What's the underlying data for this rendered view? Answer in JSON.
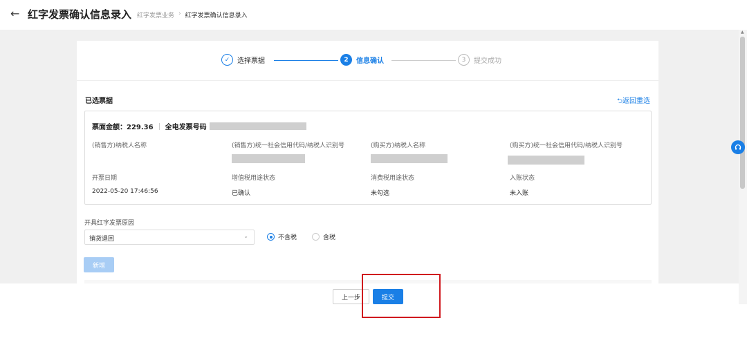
{
  "header": {
    "title": "红字发票确认信息录入",
    "breadcrumb": [
      "红字发票业务",
      "红字发票确认信息录入"
    ],
    "breadcrumb_sep": "›"
  },
  "steps": [
    {
      "index": "✓",
      "label": "选择票据",
      "state": "done"
    },
    {
      "index": "2",
      "label": "信息确认",
      "state": "active"
    },
    {
      "index": "3",
      "label": "提交成功",
      "state": "pending"
    }
  ],
  "section": {
    "title": "已选票据",
    "reselect_label": "返回重选"
  },
  "invoice": {
    "amount_label": "票面金额：229.36",
    "number_label": "全电发票号码",
    "fields": [
      {
        "label": "(销售方)纳税人名称",
        "value": ""
      },
      {
        "label": "(销售方)统一社会信用代码/纳税人识别号",
        "value": ""
      },
      {
        "label": "(购买方)纳税人名称",
        "value": ""
      },
      {
        "label": "(购买方)统一社会信用代码/纳税人识别号",
        "value": ""
      },
      {
        "label": "开票日期",
        "value": "2022-05-20 17:46:56"
      },
      {
        "label": "增值税用途状态",
        "value": "已确认"
      },
      {
        "label": "消费税用途状态",
        "value": "未勾选"
      },
      {
        "label": "入账状态",
        "value": "未入账"
      }
    ]
  },
  "reason": {
    "label": "开具红字发票原因",
    "selected": "销货退回",
    "options": [
      "不含税",
      "含税"
    ],
    "checked_index": 0
  },
  "add_label": "新增",
  "footer": {
    "prev_label": "上一步",
    "submit_label": "提交"
  },
  "colors": {
    "accent": "#1a7fe6",
    "highlight": "#d0191e"
  }
}
